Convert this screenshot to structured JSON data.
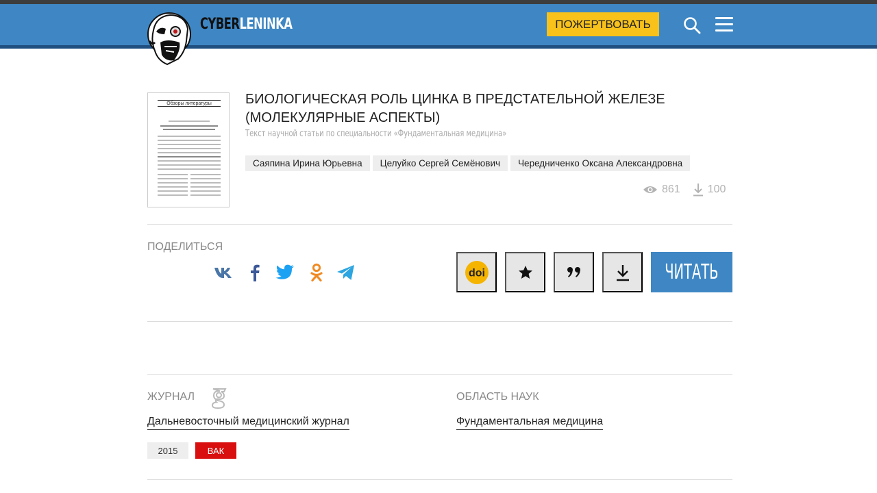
{
  "header": {
    "logo_part1": "CYBER",
    "logo_part2": "LENINKA",
    "donate_label": "ПОЖЕРТВОВАТЬ",
    "search_icon": "search-icon",
    "menu_icon": "hamburger-menu-icon"
  },
  "article": {
    "thumbnail_header": "Обзоры литературы",
    "title": "БИОЛОГИЧЕСКАЯ РОЛЬ ЦИНКА В ПРЕДСТАТЕЛЬНОЙ ЖЕЛЕЗЕ (МОЛЕКУЛЯРНЫЕ АСПЕКТЫ)",
    "subtitle": "Текст научной статьи по специальности «Фундаментальная медицина»",
    "authors": [
      "Саяпина Ирина Юрьевна",
      "Целуйко Сергей Семёнович",
      "Чередниченко Оксана Александровна"
    ],
    "views": "861",
    "downloads": "100"
  },
  "share": {
    "label": "ПОДЕЛИТЬСЯ",
    "networks": [
      "vk-icon",
      "facebook-icon",
      "twitter-icon",
      "odnoklassniki-icon",
      "telegram-icon"
    ]
  },
  "actions": {
    "doi_label": "doi",
    "read_label": "ЧИТАТЬ"
  },
  "journal": {
    "label": "ЖУРНАЛ",
    "name": "Дальневосточный медицинский журнал",
    "year": "2015",
    "badge": "ВАК"
  },
  "field": {
    "label": "ОБЛАСТЬ НАУК",
    "name": "Фундаментальная медицина"
  },
  "colors": {
    "header_blue": "#3e87c4",
    "donate_yellow": "#f8c21a",
    "vak_red": "#d90f0f",
    "doi_yellow": "#f5b400"
  }
}
